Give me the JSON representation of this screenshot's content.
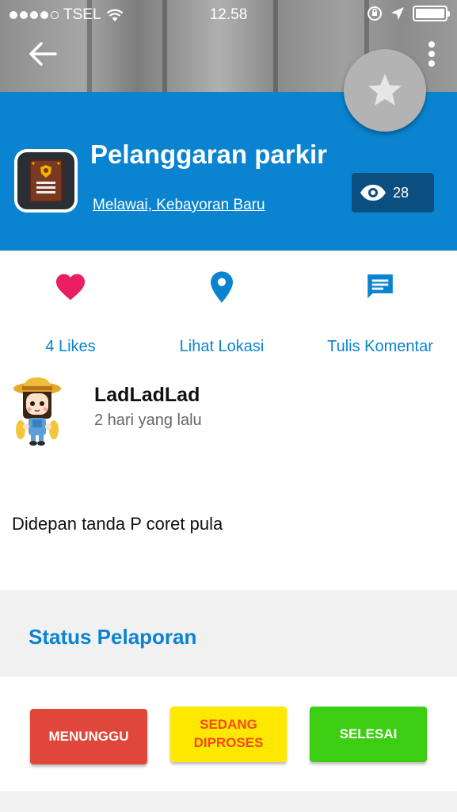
{
  "status_bar": {
    "carrier": "TSEL",
    "time": "12.58",
    "signal_bars_filled": 4,
    "signal_bars_total": 5,
    "battery_level": 1.0
  },
  "header": {
    "back_icon": "arrow-left-icon",
    "menu_icon": "more-vertical-icon",
    "favorite_icon": "star-icon"
  },
  "report": {
    "title": "Pelanggaran parkir",
    "location": "Melawai, Kebayoran Baru",
    "views": "28",
    "category_icon": "police-badge-document-icon"
  },
  "actions": [
    {
      "label": "4 Likes",
      "icon": "heart-icon",
      "color": "#e91e63"
    },
    {
      "label": "Lihat Lokasi",
      "icon": "map-pin-icon",
      "color": "#0a84d0"
    },
    {
      "label": "Tulis Komentar",
      "icon": "comment-icon",
      "color": "#0a84d0"
    }
  ],
  "author": {
    "name": "LadLadLad",
    "time_ago": "2 hari yang lalu",
    "avatar_icon": "farmer-avatar"
  },
  "description": "Didepan tanda P coret pula",
  "status_section": {
    "title": "Status Pelaporan",
    "buttons": {
      "waiting": "MENUNGGU",
      "processing_line1": "SEDANG",
      "processing_line2": "DIPROSES",
      "done": "SELESAI"
    }
  },
  "colors": {
    "primary_blue": "#0a84d0",
    "dark_blue_badge": "#0a4f80",
    "waiting_red": "#e0463a",
    "processing_yellow": "#ffe800",
    "done_green": "#3dce13",
    "like_pink": "#e91e63"
  }
}
